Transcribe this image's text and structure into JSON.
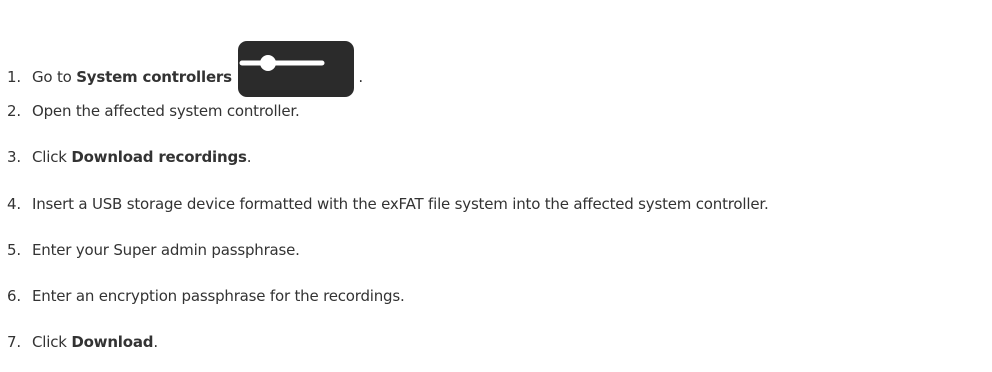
{
  "steps": [
    {
      "number": "1.",
      "before": "Go to ",
      "bold": "System controllers",
      "after": " .",
      "icon": "system-controllers-icon"
    },
    {
      "number": "2.",
      "before": "Open the affected system controller.",
      "bold": "",
      "after": ""
    },
    {
      "number": "3.",
      "before": "Click ",
      "bold": "Download recordings",
      "after": "."
    },
    {
      "number": "4.",
      "before": "Insert a USB storage device formatted with the exFAT file system into the affected system controller.",
      "bold": "",
      "after": ""
    },
    {
      "number": "5.",
      "before": "Enter your Super admin passphrase.",
      "bold": "",
      "after": ""
    },
    {
      "number": "6.",
      "before": "Enter an encryption passphrase for the recordings.",
      "bold": "",
      "after": ""
    },
    {
      "number": "7.",
      "before": "Click ",
      "bold": "Download",
      "after": "."
    }
  ],
  "colors": {
    "text": "#333333",
    "icon": "#2b2b2b"
  }
}
